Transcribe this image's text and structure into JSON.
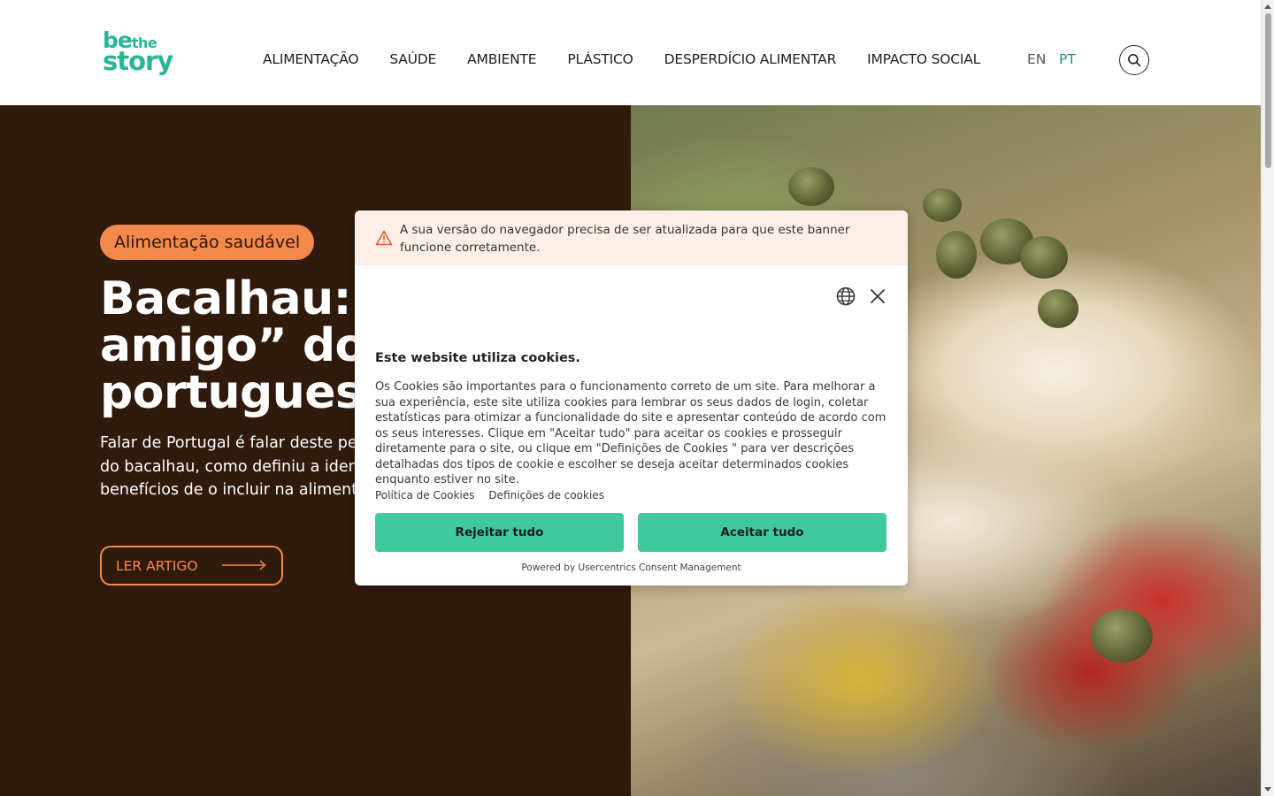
{
  "header": {
    "logo": {
      "be": "be",
      "the": "the",
      "story": "story"
    },
    "nav": [
      "ALIMENTAÇÃO",
      "SAÚDE",
      "AMBIENTE",
      "PLÁSTICO",
      "DESPERDÍCIO ALIMENTAR",
      "IMPACTO SOCIAL"
    ],
    "languages": {
      "en": "EN",
      "pt": "PT",
      "active": "PT"
    },
    "search_icon": "search-icon"
  },
  "hero": {
    "tag": "Alimentação saudável",
    "title_line1": "Bacalhau: o",
    "title_line2": "amigo” dos",
    "title_line3": "portuguese",
    "desc_line1": "Falar de Portugal é falar deste peix",
    "desc_line2": "do bacalhau, como definiu a identi",
    "desc_line3": "benefícios de o incluir na alimenta",
    "button": "LER ARTIGO"
  },
  "cookie_banner": {
    "warning": "A sua versão do navegador precisa de ser atualizada para que este banner funcione corretamente.",
    "title": "Este website utiliza cookies.",
    "body": "Os Cookies são importantes para o funcionamento correto de um site. Para melhorar a sua experiência, este site utiliza cookies para lembrar os seus dados de login, coletar estatísticas para otimizar a funcionalidade do site e apresentar conteúdo de acordo com os seus interesses. Clique em \"Aceitar tudo\" para aceitar os cookies e prosseguir diretamente para o site, ou clique em \"Definições de Cookies \" para ver descrições detalhadas dos tipos de cookie e escolher se deseja aceitar determinados cookies enquanto estiver no site.",
    "link_policy": "Política de Cookies",
    "link_settings": "Definições de cookies",
    "reject": "Rejeitar tudo",
    "accept": "Aceitar tudo",
    "powered_by": "Powered by Usercentrics Consent Management"
  },
  "colors": {
    "brand": "#2bb597",
    "hero_bg": "#301a0c",
    "accent": "#f4894b",
    "button_green": "#40c99f",
    "warning_bg": "#fcefe7"
  }
}
